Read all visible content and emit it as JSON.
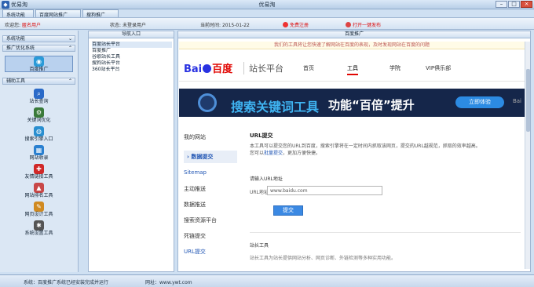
{
  "window": {
    "small_title": "优易淘",
    "title": "优易淘"
  },
  "tabs": [
    "系统功能",
    "百度网站推广",
    "搜狗推广"
  ],
  "toolbar": {
    "welcome": "欢迎您",
    "username": "匿名用户",
    "status_label": "状态",
    "status_value": "未登录用户",
    "date_label": "当前时间",
    "date_value": "2015-01-22",
    "free_link": "免费注册",
    "open_link": "打开一键发布"
  },
  "sidebar": {
    "sections": [
      {
        "label": "系统功能",
        "collapsed": true
      },
      {
        "label": "推广优化系统",
        "collapsed": false
      },
      {
        "label": "辅助工具",
        "collapsed": false
      }
    ],
    "items": [
      {
        "label": "百度推广",
        "icon": "globe-icon",
        "color": "#2a9ad8"
      },
      {
        "label": "站长查询",
        "icon": "magnifier-icon",
        "color": "#2a6ac8"
      },
      {
        "label": "关键词优化",
        "icon": "gear-icon",
        "color": "#3a7a3a"
      },
      {
        "label": "搜索引擎入口",
        "icon": "globe-icon",
        "color": "#2a8fd0"
      },
      {
        "label": "网站收录",
        "icon": "grid-icon",
        "color": "#2a80d0"
      },
      {
        "label": "友情链接工具",
        "icon": "plus-icon",
        "color": "#d02828"
      },
      {
        "label": "网站排名工具",
        "icon": "chart-icon",
        "color": "#c84848"
      },
      {
        "label": "网页设计工具",
        "icon": "brush-icon",
        "color": "#d08a20"
      },
      {
        "label": "系统设置工具",
        "icon": "settings-icon",
        "color": "#555555"
      }
    ]
  },
  "nav_panel": {
    "title": "导航入口",
    "items": [
      "百度站长平台",
      "百度推广",
      "谷歌站长工具",
      "搜狗站长平台",
      "360站长平台"
    ]
  },
  "main_panel": {
    "title": "百度推广"
  },
  "page": {
    "notice": "我们的工具将让您快速了解网站在百度的表现，及时发现网站在百度的问题",
    "brand": "百度",
    "brand_sub": "站长平台",
    "site_nav": [
      "首页",
      "工具",
      "学院",
      "VIP俱乐部"
    ],
    "banner": {
      "main": "搜索关键词工具",
      "sub": "功能“百倍”提升",
      "button": "立即体验",
      "extra": "Bai"
    },
    "subnav": [
      {
        "label": "我的网站",
        "kind": "normal"
      },
      {
        "label": "数据提交",
        "kind": "current"
      },
      {
        "label": "Sitemap",
        "kind": "link"
      },
      {
        "label": "主动推送",
        "kind": "normal"
      },
      {
        "label": "数据推送",
        "kind": "normal"
      },
      {
        "label": "搜索资源平台",
        "kind": "normal"
      },
      {
        "label": "死链提交",
        "kind": "normal"
      },
      {
        "label": "URL提交",
        "kind": "link"
      }
    ],
    "content": {
      "title": "URL提交",
      "text_line1": "本工具可以提交您的URL到百度，搜索引擎将在一定时间内抓取该网页，提交的URL越规范，抓取的效率越高。",
      "text_line2_pre": "您可以",
      "text_link": "批量提交",
      "text_line2_post": "，更加方便快捷。",
      "label": "请输入URL地址",
      "url_label": "URL地址",
      "url_value": "www.baidu.com",
      "submit": "提交",
      "section2": "站长工具",
      "text2": "站长工具为站长提供网站分析、网页诊断、外链检测等多种实用功能。"
    }
  },
  "status": {
    "left": "系统：百度推广系统已经安装完成并运行",
    "right": "网址：www.ywt.com"
  }
}
